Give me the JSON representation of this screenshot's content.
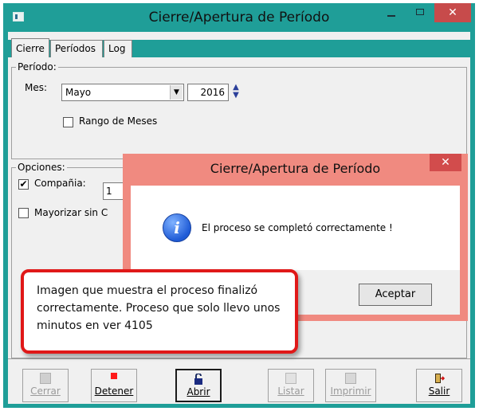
{
  "window": {
    "title": "Cierre/Apertura de Período",
    "minimize_glyph": "–",
    "close_glyph": "✕"
  },
  "tabs": [
    {
      "label": "Cierre"
    },
    {
      "label": "Períodos"
    },
    {
      "label": "Log"
    }
  ],
  "periodo": {
    "legend": "Período:",
    "mes_label": "Mes:",
    "mes_value": "Mayo",
    "year_value": "2016",
    "rango_label": "Rango de Meses",
    "rango_checked": false
  },
  "opciones": {
    "legend": "Opciones:",
    "compania_label": "Compañia:",
    "compania_checked": true,
    "compania_value": "1",
    "mayorizar_label": "Mayorizar sin C",
    "mayorizar_checked": false
  },
  "toolbar": {
    "cerrar": "Cerrar",
    "detener": "Detener",
    "abrir": "Abrir",
    "listar": "Listar",
    "imprimir": "Imprimir",
    "salir": "Salir"
  },
  "dialog": {
    "title": "Cierre/Apertura de Período",
    "message": "El proceso se completó correctamente !",
    "ok_label": "Aceptar",
    "close_glyph": "✕"
  },
  "annotation": {
    "text": "Imagen que muestra el proceso finalizó correctamente. Proceso que solo llevo unos minutos en ver 4105"
  },
  "colors": {
    "titlebar": "#1f9e98",
    "dialog_frame": "#f08a80",
    "callout_border": "#e01818"
  },
  "icons": {
    "app": "window-icon",
    "info": "info-icon",
    "stop": "stop-icon",
    "lock": "lock-icon",
    "exit": "exit-door-icon"
  }
}
